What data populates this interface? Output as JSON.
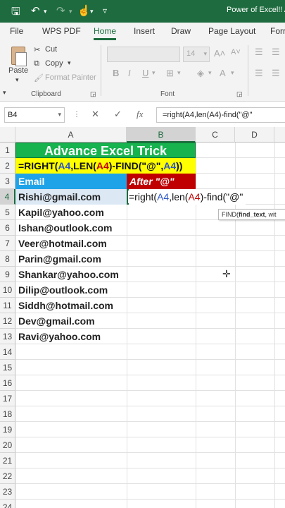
{
  "titlebar": {
    "title": "Power of Excel!! A",
    "icons": [
      "save-icon",
      "undo-icon",
      "redo-icon",
      "touch-mode-icon",
      "customize-icon"
    ]
  },
  "tabs": [
    "File",
    "WPS PDF",
    "Home",
    "Insert",
    "Draw",
    "Page Layout",
    "Forr"
  ],
  "active_tab": "Home",
  "ribbon": {
    "paste": "Paste",
    "cut": "Cut",
    "copy": "Copy",
    "format_painter": "Format Painter",
    "clipboard": "Clipboard",
    "font_size": "14",
    "font_group": "Font"
  },
  "formula_bar": {
    "name_box": "B4",
    "formula": "=right(A4,len(A4)-find(\"@\""
  },
  "columns": [
    "A",
    "B",
    "C",
    "D"
  ],
  "rows": [
    "1",
    "2",
    "3",
    "4",
    "5",
    "6",
    "7",
    "8",
    "9",
    "10",
    "11",
    "12",
    "13",
    "14",
    "15",
    "16",
    "17",
    "18",
    "19",
    "20",
    "21",
    "22",
    "23",
    "24"
  ],
  "sheet": {
    "banner": "Advance Excel Trick",
    "formula_display": {
      "p1": "=RIGHT(",
      "p2": "A4",
      "p3": ",LEN(",
      "p4": "A4",
      "p5": ")-FIND(\"@\",",
      "p6": "A4",
      "p7": "))"
    },
    "email_header": "Email",
    "after_header": "After \"@\"",
    "emails": [
      "Rishi@gmail.com",
      "Kapil@yahoo.com",
      "Ishan@outlook.com",
      "Veer@hotmail.com",
      "Parin@gmail.com",
      "Shankar@yahoo.com",
      "Dilip@outlook.com",
      "Siddh@hotmail.com",
      "Dev@gmail.com",
      "Ravi@yahoo.com"
    ],
    "editing": {
      "p1": "=right(",
      "p2": "A4",
      "p3": ",",
      "p4": "len",
      "p5": "(",
      "p6": "A4",
      "p7": ")-find(\"@\""
    },
    "tooltip": {
      "fn": "FIND(",
      "arg": "find_text",
      "rest": ", wit"
    }
  },
  "colors": {
    "accent": "#1d6b3e",
    "banner": "#16b34f",
    "formula_bg": "#ffff00",
    "email_header": "#1fa3e8",
    "after_header": "#c00000"
  }
}
